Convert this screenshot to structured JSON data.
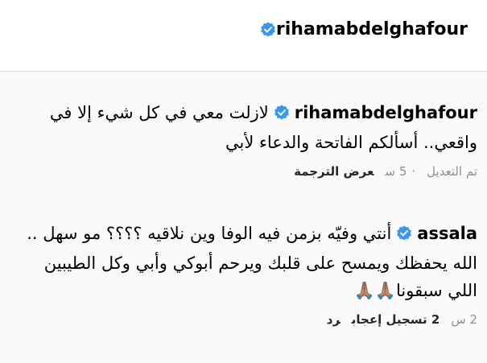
{
  "header": {
    "username": "rihamabdelghafour"
  },
  "comments": [
    {
      "username": "rihamabdelghafour",
      "text": "لازلت معي في كل شيء إلا في واقعي.. أسألكم الفاتحة والدعاء لأبي",
      "meta": {
        "edited": "تم التعديل",
        "separator": "·",
        "time": "5 س",
        "translate": "عرض الترجمة"
      }
    },
    {
      "username": "assala",
      "text": "أنتي وفيّه بزمن فيه الوفا وين نلاقيه ؟؟؟؟ مو سهل .. الله يحفظك ويمسح على قلبك ويرحم أبوكي وأبي وكل الطيبين اللي سبقونا🙏🏽🙏🏽",
      "meta": {
        "time": "2 س",
        "likes": "2 تسجيل إعجاب",
        "reply": "رد"
      }
    }
  ],
  "colors": {
    "verified": "#3897f0",
    "meta_gray": "#8e8e8e"
  },
  "icons": {
    "verified": "verified-badge-icon"
  }
}
